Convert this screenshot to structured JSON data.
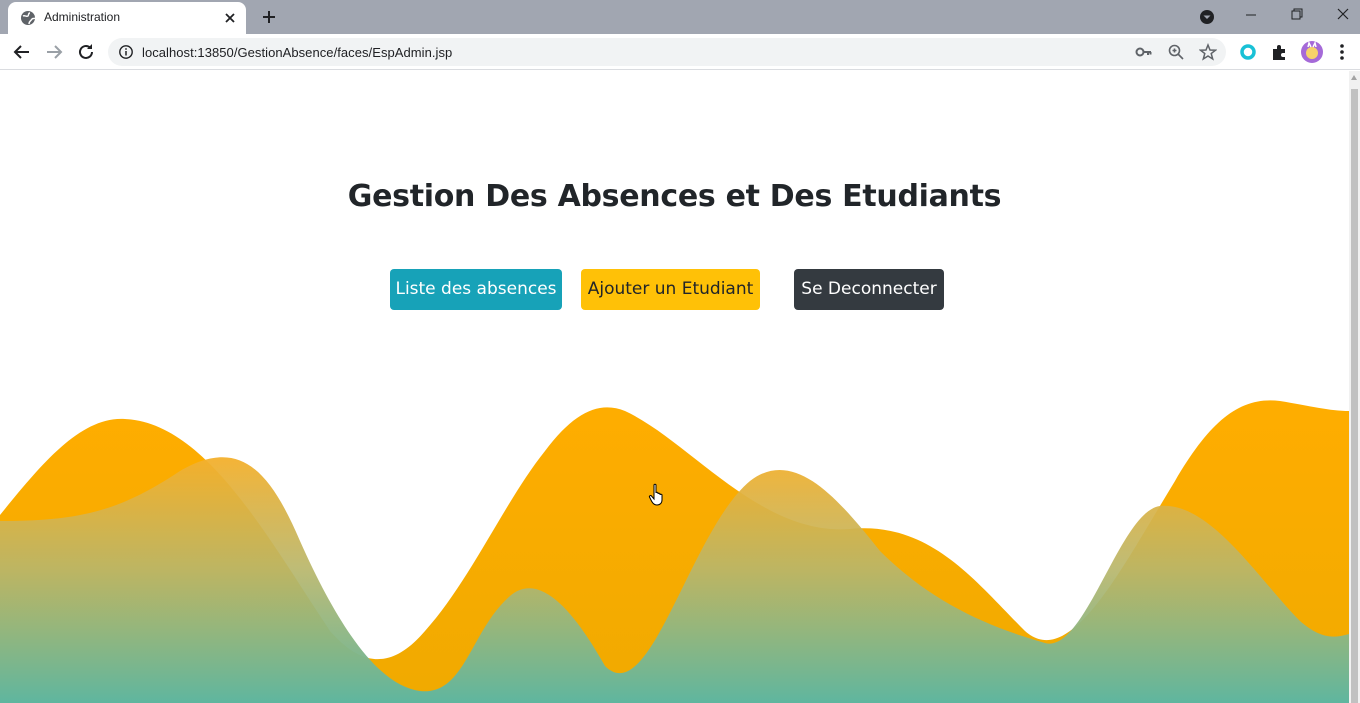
{
  "browser": {
    "tab_title": "Administration",
    "url": "localhost:13850/GestionAbsence/faces/EspAdmin.jsp",
    "icons": [
      "globe-icon",
      "close-icon",
      "plus-icon",
      "tab-search-icon",
      "minimize-icon",
      "maximize-icon",
      "window-close-icon",
      "back-icon",
      "forward-icon",
      "reload-icon",
      "info-icon",
      "key-icon",
      "zoom-icon",
      "star-icon",
      "extension-icon",
      "puzzle-icon",
      "avatar",
      "menu-icon"
    ]
  },
  "page": {
    "title": "Gestion Des Absences et Des Etudiants",
    "buttons": {
      "absences": "Liste des absences",
      "add_student": "Ajouter un Etudiant",
      "logout": "Se Deconnecter"
    }
  },
  "colors": {
    "info": "#17a2b8",
    "warning": "#ffc107",
    "dark": "#343a40",
    "wave_orange": "#ffae00",
    "wave_teal": "#5db8a0"
  }
}
